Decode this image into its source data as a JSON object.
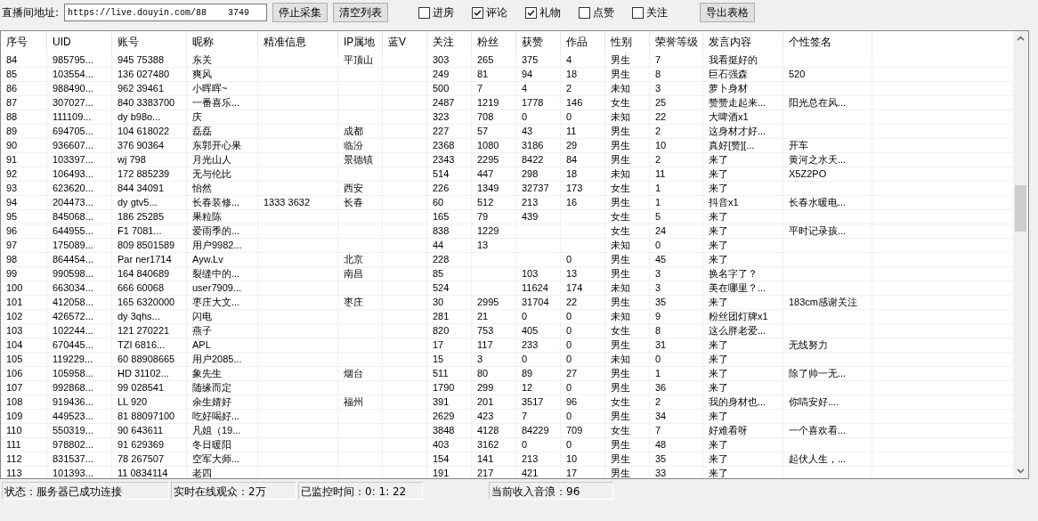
{
  "toolbar": {
    "url_label": "直播间地址:",
    "url_value": "https://live.douyin.com/88    3749",
    "buttons": [
      "停止采集",
      "清空列表"
    ],
    "options": [
      {
        "label": "进房",
        "checked": false
      },
      {
        "label": "评论",
        "checked": true
      },
      {
        "label": "礼物",
        "checked": true
      },
      {
        "label": "点赞",
        "checked": false
      },
      {
        "label": "关注",
        "checked": false
      }
    ],
    "export_button": "导出表格"
  },
  "table": {
    "columns": [
      "序号",
      "UID",
      "账号",
      "昵称",
      "精准信息",
      "IP属地",
      "蓝V",
      "关注",
      "粉丝",
      "获赞",
      "作品",
      "性别",
      "荣誉等级",
      "发言内容",
      "个性签名"
    ],
    "rows": [
      {
        "no": "84",
        "uid": "985795...",
        "account": "945 75388",
        "nickname": "东关",
        "ip": "平顶山",
        "follow": "303",
        "fans": "265",
        "likes": "375",
        "works": "4",
        "gender": "男生",
        "level": "7",
        "comment": "我看挺好的"
      },
      {
        "no": "85",
        "uid": "103554...",
        "account": "136 027480",
        "nickname": "爽风",
        "follow": "249",
        "fans": "81",
        "likes": "94",
        "works": "18",
        "gender": "男生",
        "level": "8",
        "comment": "巨石强森",
        "signature": "520"
      },
      {
        "no": "86",
        "uid": "988490...",
        "account": "962 39461",
        "nickname": "小晖晖~",
        "follow": "500",
        "fans": "7",
        "likes": "4",
        "works": "2",
        "gender": "未知",
        "level": "3",
        "comment": "萝卜身材"
      },
      {
        "no": "87",
        "uid": "307027...",
        "account": "840 3383700",
        "nickname": "一番喜乐...",
        "follow": "2487",
        "fans": "1219",
        "likes": "1778",
        "works": "146",
        "gender": "女生",
        "level": "25",
        "comment": "赞赞走起来...",
        "signature": "阳光总在风..."
      },
      {
        "no": "88",
        "uid": "111109...",
        "account": "dy b98o...",
        "nickname": "庆",
        "follow": "323",
        "fans": "708",
        "likes": "0",
        "works": "0",
        "gender": "未知",
        "level": "22",
        "comment": "大啤酒x1"
      },
      {
        "no": "89",
        "uid": "694705...",
        "account": "104 618022",
        "nickname": "磊磊",
        "ip": "成都",
        "follow": "227",
        "fans": "57",
        "likes": "43",
        "works": "11",
        "gender": "男生",
        "level": "2",
        "comment": "这身材才好..."
      },
      {
        "no": "90",
        "uid": "936607...",
        "account": "376 90364",
        "nickname": "东郭开心果",
        "ip": "临汾",
        "follow": "2368",
        "fans": "1080",
        "likes": "3186",
        "works": "29",
        "gender": "男生",
        "level": "10",
        "comment": "真好[赞][...",
        "signature": "开车"
      },
      {
        "no": "91",
        "uid": "103397...",
        "account": "wj 798",
        "nickname": "月光山人",
        "ip": "景德镇",
        "follow": "2343",
        "fans": "2295",
        "likes": "8422",
        "works": "84",
        "gender": "男生",
        "level": "2",
        "comment": "来了",
        "signature": "黄河之水天..."
      },
      {
        "no": "92",
        "uid": "106493...",
        "account": "172 885239",
        "nickname": "无与伦比",
        "follow": "514",
        "fans": "447",
        "likes": "298",
        "works": "18",
        "gender": "未知",
        "level": "11",
        "comment": "来了",
        "signature": "X5Z2PO"
      },
      {
        "no": "93",
        "uid": "623620...",
        "account": "844 34091",
        "nickname": "怡然",
        "ip": "西安",
        "follow": "226",
        "fans": "1349",
        "likes": "32737",
        "works": "173",
        "gender": "女生",
        "level": "1",
        "comment": "来了"
      },
      {
        "no": "94",
        "uid": "204473...",
        "account": "dy gtv5...",
        "nickname": "长春装修...",
        "info": "1333    3632",
        "ip": "长春",
        "follow": "60",
        "fans": "512",
        "likes": "213",
        "works": "16",
        "gender": "男生",
        "level": "1",
        "comment": "抖音x1",
        "signature": "长春水暖电..."
      },
      {
        "no": "95",
        "uid": "845068...",
        "account": "186 25285",
        "nickname": "果粒陈",
        "follow": "165",
        "fans": "79",
        "likes": "439",
        "gender": "女生",
        "level": "5",
        "comment": "来了"
      },
      {
        "no": "96",
        "uid": "644955...",
        "account": "F1 7081...",
        "nickname": "爱雨季的...",
        "follow": "838",
        "fans": "1229",
        "gender": "女生",
        "level": "24",
        "comment": "来了",
        "signature": "平时记录孩..."
      },
      {
        "no": "97",
        "uid": "175089...",
        "account": "809 8501589",
        "nickname": "用户9982...",
        "follow": "44",
        "fans": "13",
        "gender": "未知",
        "level": "0",
        "comment": "来了"
      },
      {
        "no": "98",
        "uid": "864454...",
        "account": "Par ner1714",
        "nickname": "Ayw.Lv",
        "ip": "北京",
        "follow": "228",
        "works": "0",
        "gender": "男生",
        "level": "45",
        "comment": "来了"
      },
      {
        "no": "99",
        "uid": "990598...",
        "account": "164 840689",
        "nickname": "裂缝中的...",
        "ip": "南昌",
        "follow": "85",
        "likes": "103",
        "works": "13",
        "gender": "男生",
        "level": "3",
        "comment": "换名字了？"
      },
      {
        "no": "100",
        "uid": "663034...",
        "account": "666 60068",
        "nickname": "user7909...",
        "follow": "524",
        "likes": "11624",
        "works": "174",
        "gender": "未知",
        "level": "3",
        "comment": "美在哪里？..."
      },
      {
        "no": "101",
        "uid": "412058...",
        "account": "165 6320000",
        "nickname": "枣庄大文...",
        "ip": "枣庄",
        "follow": "30",
        "fans": "2995",
        "likes": "31704",
        "works": "22",
        "gender": "男生",
        "level": "35",
        "comment": "来了",
        "signature": "183cm感谢关注"
      },
      {
        "no": "102",
        "uid": "426572...",
        "account": "dy 3qhs...",
        "nickname": "闪电",
        "follow": "281",
        "fans": "21",
        "likes": "0",
        "works": "0",
        "gender": "未知",
        "level": "9",
        "comment": "粉丝团灯牌x1"
      },
      {
        "no": "103",
        "uid": "102244...",
        "account": "121 270221",
        "nickname": "燕子",
        "follow": "820",
        "fans": "753",
        "likes": "405",
        "works": "0",
        "gender": "女生",
        "level": "8",
        "comment": "这么胖老爱..."
      },
      {
        "no": "104",
        "uid": "670445...",
        "account": "TZI 6816...",
        "nickname": "APL",
        "follow": "17",
        "fans": "117",
        "likes": "233",
        "works": "0",
        "gender": "男生",
        "level": "31",
        "comment": "来了",
        "signature": "无线努力"
      },
      {
        "no": "105",
        "uid": "119229...",
        "account": "60 88908665",
        "nickname": "用户2085...",
        "follow": "15",
        "fans": "3",
        "likes": "0",
        "works": "0",
        "gender": "未知",
        "level": "0",
        "comment": "来了"
      },
      {
        "no": "106",
        "uid": "105958...",
        "account": "HD 31102...",
        "nickname": "象先生",
        "ip": "烟台",
        "follow": "511",
        "fans": "80",
        "likes": "89",
        "works": "27",
        "gender": "男生",
        "level": "1",
        "comment": "来了",
        "signature": "除了帅一无..."
      },
      {
        "no": "107",
        "uid": "992868...",
        "account": "99 028541",
        "nickname": "随缘而定",
        "follow": "1790",
        "fans": "299",
        "likes": "12",
        "works": "0",
        "gender": "男生",
        "level": "36",
        "comment": "来了"
      },
      {
        "no": "108",
        "uid": "919436...",
        "account": "LL 920",
        "nickname": "余生婧好",
        "ip": "福州",
        "follow": "391",
        "fans": "201",
        "likes": "3517",
        "works": "96",
        "gender": "女生",
        "level": "2",
        "comment": "我的身材也...",
        "signature": "你嗃安好...."
      },
      {
        "no": "109",
        "uid": "449523...",
        "account": "81 88097100",
        "nickname": "吃好喝好...",
        "follow": "2629",
        "fans": "423",
        "likes": "7",
        "works": "0",
        "gender": "男生",
        "level": "34",
        "comment": "来了"
      },
      {
        "no": "110",
        "uid": "550319...",
        "account": "90 643611",
        "nickname": "凡姐（19...",
        "follow": "3848",
        "fans": "4128",
        "likes": "84229",
        "works": "709",
        "gender": "女生",
        "level": "7",
        "comment": "好难看呀",
        "signature": "一个喜欢看..."
      },
      {
        "no": "111",
        "uid": "978802...",
        "account": "91 629369",
        "nickname": "冬日暖阳",
        "follow": "403",
        "fans": "3162",
        "likes": "0",
        "works": "0",
        "gender": "男生",
        "level": "48",
        "comment": "来了"
      },
      {
        "no": "112",
        "uid": "831537...",
        "account": "78 267507",
        "nickname": "空军大师...",
        "follow": "154",
        "fans": "141",
        "likes": "213",
        "works": "10",
        "gender": "男生",
        "level": "35",
        "comment": "来了",
        "signature": "起伏人生，..."
      },
      {
        "no": "113",
        "uid": "101393...",
        "account": "11 0834114",
        "nickname": "老四",
        "follow": "191",
        "fans": "217",
        "likes": "421",
        "works": "17",
        "gender": "男生",
        "level": "33",
        "comment": "来了"
      }
    ]
  },
  "status_bar": [
    "状态：服务器已成功连接",
    "实时在线观众：2万",
    "已监控时间：0: 1: 22",
    "当前收入音浪：96"
  ]
}
